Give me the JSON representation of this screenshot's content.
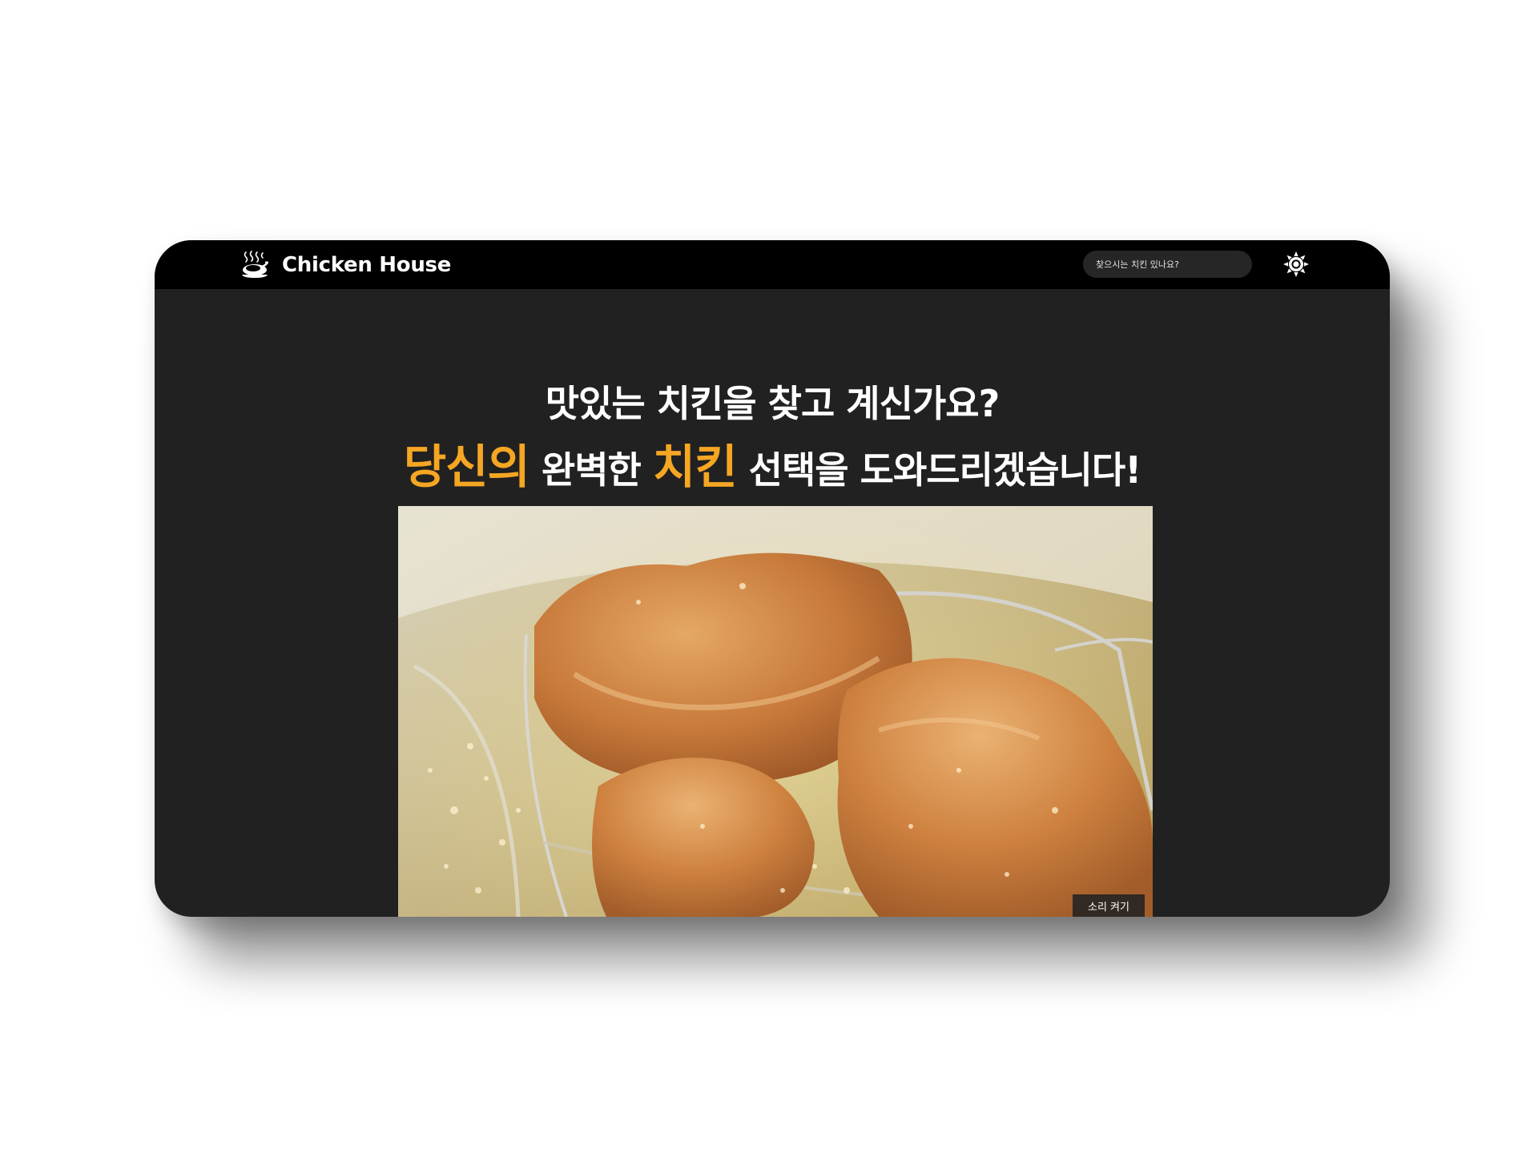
{
  "header": {
    "brand_name": "Chicken House",
    "brand_icon": "roast-chicken-icon",
    "search_placeholder": "찾으시는 치킨 있나요?",
    "theme_toggle_icon": "sun-icon"
  },
  "hero": {
    "headline_line1": "맛있는 치킨을 찾고 계신가요?",
    "headline_line2": {
      "part1": "당신의",
      "part2": " 완벽한 ",
      "part3": "치킨",
      "part4": " 선택을 도와드리겠습니다!"
    },
    "accent_color": "#f5a623",
    "video": {
      "subject": "fried-chicken-in-fryer-image",
      "sound_button_label": "소리 켜기"
    }
  },
  "colors": {
    "navbar_background": "#000000",
    "page_background": "#212121",
    "text": "#ffffff"
  }
}
